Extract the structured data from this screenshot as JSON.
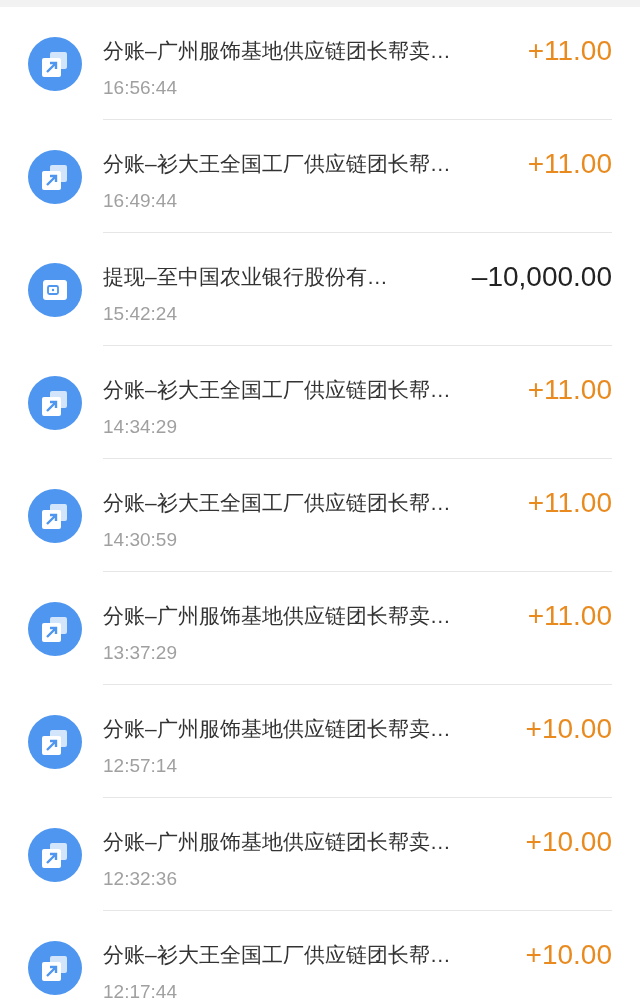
{
  "transactions": [
    {
      "kind": "split",
      "title": "分账–广州服饰基地供应链团长帮卖…",
      "time": "16:56:44",
      "amount": "+11.00"
    },
    {
      "kind": "split",
      "title": "分账–衫大王全国工厂供应链团长帮…",
      "time": "16:49:44",
      "amount": "+11.00"
    },
    {
      "kind": "withdraw",
      "title": "提现–至中国农业银行股份有…",
      "time": "15:42:24",
      "amount": "–10,000.00"
    },
    {
      "kind": "split",
      "title": "分账–衫大王全国工厂供应链团长帮…",
      "time": "14:34:29",
      "amount": "+11.00"
    },
    {
      "kind": "split",
      "title": "分账–衫大王全国工厂供应链团长帮…",
      "time": "14:30:59",
      "amount": "+11.00"
    },
    {
      "kind": "split",
      "title": "分账–广州服饰基地供应链团长帮卖…",
      "time": "13:37:29",
      "amount": "+11.00"
    },
    {
      "kind": "split",
      "title": "分账–广州服饰基地供应链团长帮卖…",
      "time": "12:57:14",
      "amount": "+10.00"
    },
    {
      "kind": "split",
      "title": "分账–广州服饰基地供应链团长帮卖…",
      "time": "12:32:36",
      "amount": "+10.00"
    },
    {
      "kind": "split",
      "title": "分账–衫大王全国工厂供应链团长帮…",
      "time": "12:17:44",
      "amount": "+10.00"
    }
  ]
}
